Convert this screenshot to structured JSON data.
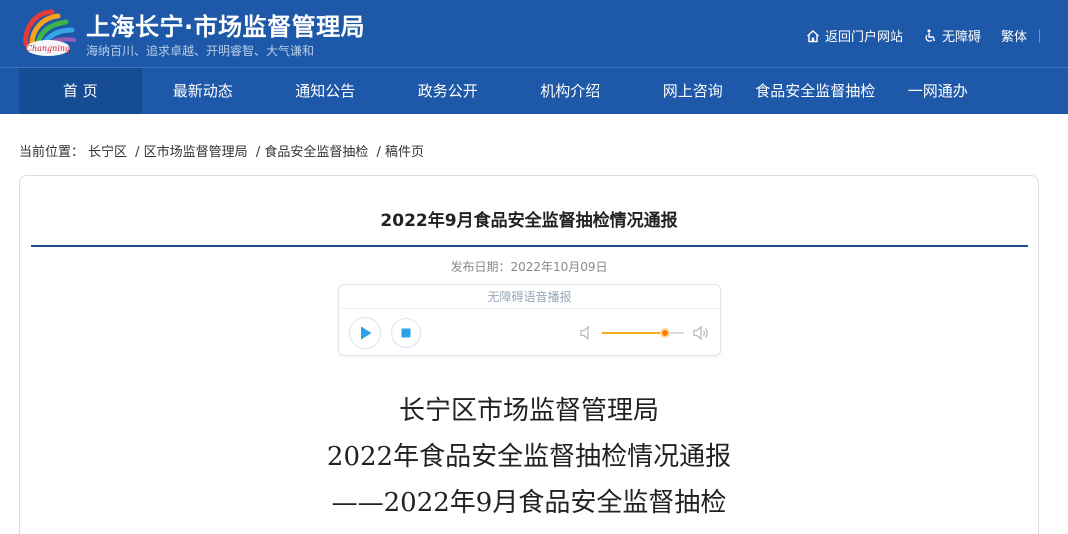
{
  "header": {
    "title": "上海长宁·市场监督管理局",
    "slogan": "海纳百川、追求卓越、开明睿智、大气谦和",
    "logo_icon": "changning-logo-icon",
    "brand_color": "#1e58a8",
    "links": [
      {
        "label": "返回门户网站",
        "icon": "home-icon"
      },
      {
        "label": "无障碍",
        "icon": "wheelchair-icon"
      },
      {
        "label": "繁体"
      }
    ]
  },
  "nav": {
    "items": [
      {
        "label": "首 页",
        "active": true
      },
      {
        "label": "最新动态"
      },
      {
        "label": "通知公告"
      },
      {
        "label": "政务公开"
      },
      {
        "label": "机构介绍"
      },
      {
        "label": "网上咨询"
      },
      {
        "label": "食品安全监督抽检"
      },
      {
        "label": "一网通办"
      }
    ]
  },
  "breadcrumb": {
    "prefix": "当前位置：",
    "items": [
      "长宁区",
      "/ 区市场监督管理局",
      "/ 食品安全监督抽检",
      "/ 稿件页"
    ]
  },
  "article": {
    "title": "2022年9月食品安全监督抽检情况通报",
    "publish_date": "发布日期：2022年10月09日",
    "heading_lines": [
      "长宁区市场监督管理局",
      "2022年食品安全监督抽检情况通报",
      "——2022年9月食品安全监督抽检"
    ]
  },
  "player": {
    "label": "无障碍语音播报",
    "volume_fraction": 0.77,
    "accent_color": "#29a3e6",
    "knob_color": "#ff7a00"
  }
}
